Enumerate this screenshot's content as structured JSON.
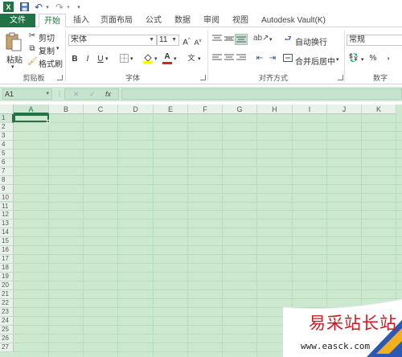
{
  "qat": {
    "icons": [
      "excel-logo-icon",
      "save-icon",
      "undo-icon",
      "redo-icon",
      "customize-icon"
    ]
  },
  "tabs": [
    {
      "label": "文件"
    },
    {
      "label": "开始"
    },
    {
      "label": "插入"
    },
    {
      "label": "页面布局"
    },
    {
      "label": "公式"
    },
    {
      "label": "数据"
    },
    {
      "label": "审阅"
    },
    {
      "label": "视图"
    },
    {
      "label": "Autodesk Vault(K)"
    }
  ],
  "ribbon": {
    "clipboard": {
      "paste": "粘贴",
      "cut": "剪切",
      "copy": "复制",
      "format_painter": "格式刷",
      "group": "剪贴板"
    },
    "font": {
      "font_name": "宋体",
      "font_size": "11",
      "bold": "B",
      "italic": "I",
      "underline": "U",
      "group": "字体"
    },
    "alignment": {
      "wrap_text": "自动换行",
      "merge_center": "合并后居中",
      "group": "对齐方式"
    },
    "number": {
      "format": "常规",
      "percent": "%",
      "comma": ",",
      "group": "数字"
    }
  },
  "formula_bar": {
    "name_box": "A1",
    "fx": "fx",
    "cancel": "✕",
    "enter": "✓"
  },
  "grid": {
    "columns": [
      "A",
      "B",
      "C",
      "D",
      "E",
      "F",
      "G",
      "H",
      "I",
      "J",
      "K"
    ],
    "rows": [
      "1",
      "2",
      "3",
      "4",
      "5",
      "6",
      "7",
      "8",
      "9",
      "10",
      "11",
      "12",
      "13",
      "14",
      "15",
      "16",
      "17",
      "18",
      "19",
      "20",
      "21",
      "22",
      "23",
      "24",
      "25",
      "26",
      "27"
    ],
    "selected_cell": "A1"
  },
  "colors": {
    "accent": "#217346",
    "grid_bg": "#cce8cf",
    "grid_line": "#b9dcbf"
  },
  "watermark": {
    "title": "易采站长站",
    "url": "www.easck.com"
  }
}
